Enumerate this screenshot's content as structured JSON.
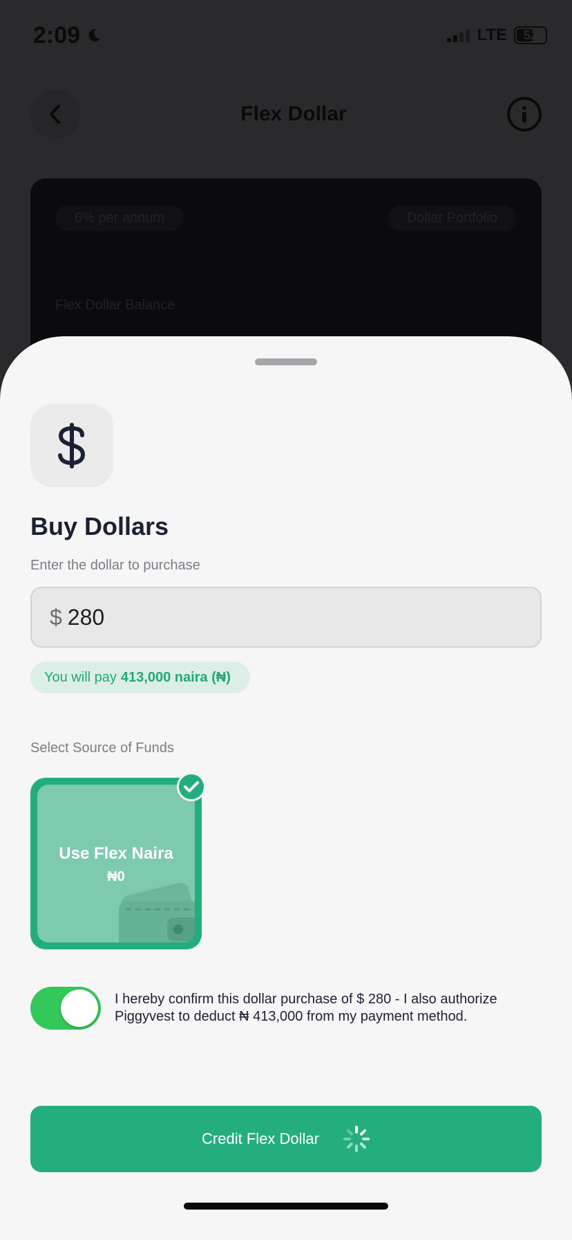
{
  "status_bar": {
    "time": "2:09",
    "network": "LTE",
    "battery": "52"
  },
  "background": {
    "title": "Flex Dollar",
    "interest_badge": "6% per annum",
    "portfolio_badge": "Dollar Portfolio",
    "balance_label": "Flex Dollar Balance"
  },
  "sheet": {
    "title": "Buy Dollars",
    "subtitle": "Enter the dollar to purchase",
    "amount": {
      "currency": "$",
      "value": "280"
    },
    "pay_notice": {
      "prefix": "You will pay",
      "amount": "413,000 naira (₦)"
    },
    "source_label": "Select Source of Funds",
    "fund_option": {
      "title": "Use Flex Naira",
      "amount": "₦0",
      "selected": true
    },
    "confirm": {
      "toggle_on": true,
      "text": "I hereby confirm this dollar purchase of $ 280 - I also authorize Piggyvest to deduct ₦ 413,000 from my payment method."
    },
    "cta_label": "Credit Flex Dollar"
  },
  "colors": {
    "accent": "#24ae7e",
    "toggle_on": "#34c759",
    "pill_bg": "#dcefe6",
    "title": "#1c2033"
  }
}
